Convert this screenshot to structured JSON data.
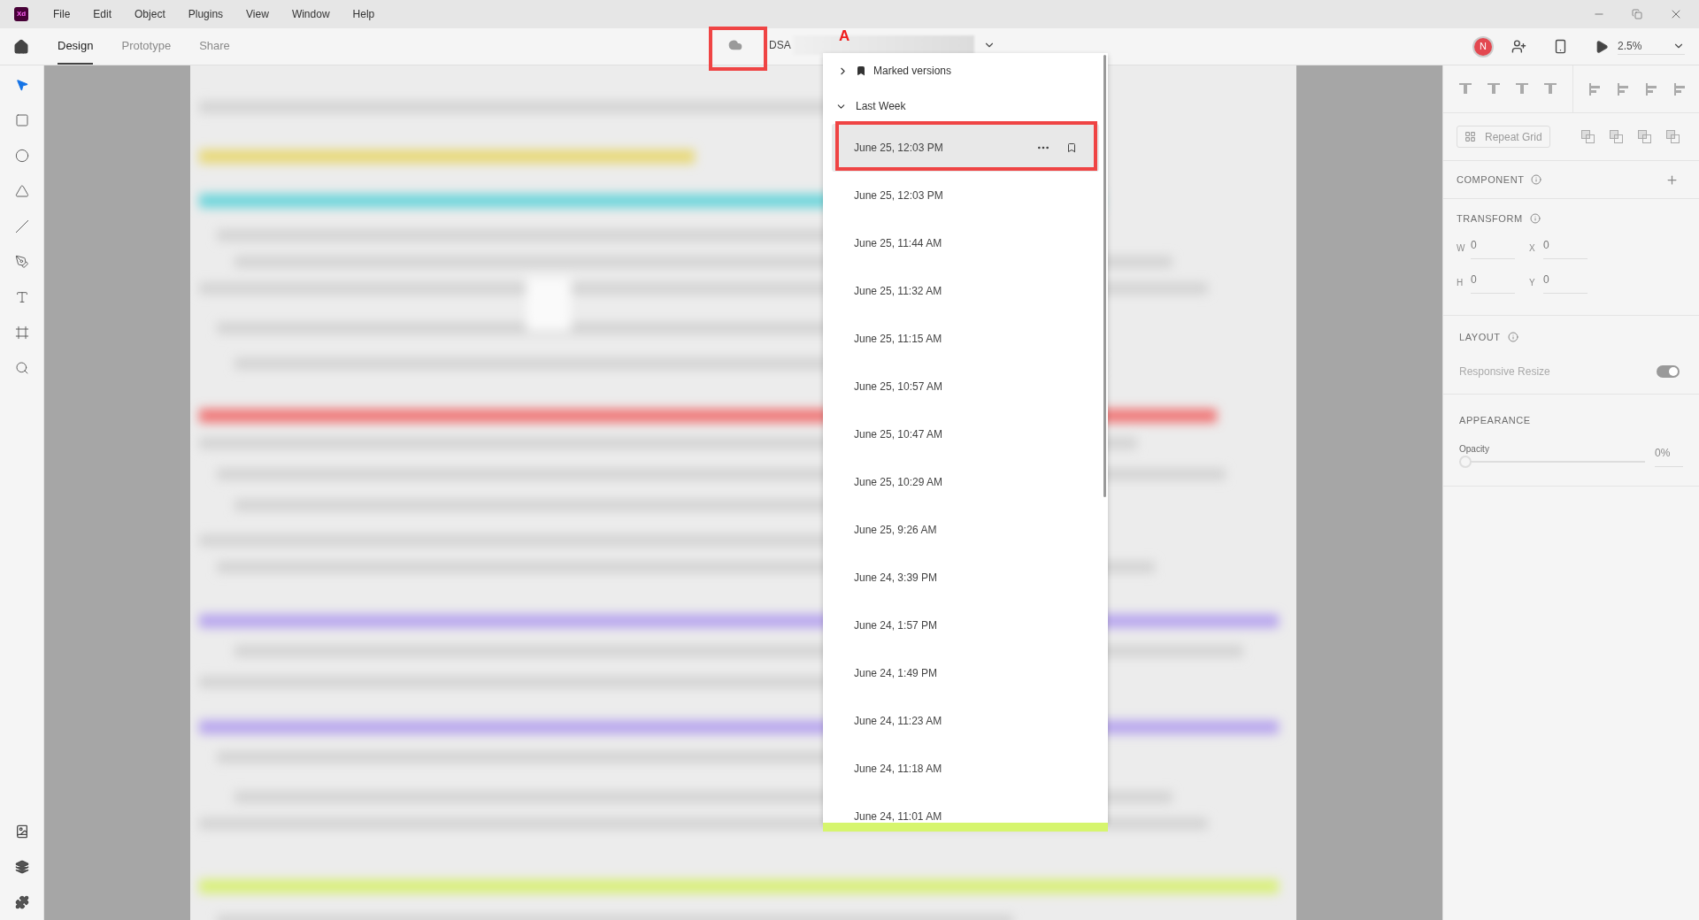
{
  "app": {
    "logo": "Xd"
  },
  "menu": [
    "File",
    "Edit",
    "Object",
    "Plugins",
    "View",
    "Window",
    "Help"
  ],
  "tabs": [
    {
      "label": "Design",
      "selected": true
    },
    {
      "label": "Prototype",
      "selected": false
    },
    {
      "label": "Share",
      "selected": false
    }
  ],
  "document": {
    "title": "DSA"
  },
  "toolbar": {
    "avatar": "N",
    "zoom": "2.5%"
  },
  "tools": [
    {
      "kind": "select",
      "selected": true
    },
    {
      "kind": "rectangle",
      "selected": false
    },
    {
      "kind": "ellipse",
      "selected": false
    },
    {
      "kind": "polygon",
      "selected": false
    },
    {
      "kind": "line",
      "selected": false
    },
    {
      "kind": "pen",
      "selected": false
    },
    {
      "kind": "text",
      "selected": false
    },
    {
      "kind": "artboard",
      "selected": false
    },
    {
      "kind": "zoom",
      "selected": false
    }
  ],
  "versions": {
    "marked": {
      "label": "Marked versions",
      "expanded": false
    },
    "last_week": {
      "label": "Last Week",
      "expanded": true,
      "items": [
        {
          "label": "June 25, 12:03 PM",
          "selected": true
        },
        {
          "label": "June 25, 12:03 PM",
          "selected": false
        },
        {
          "label": "June 25, 11:44 AM",
          "selected": false
        },
        {
          "label": "June 25, 11:32 AM",
          "selected": false
        },
        {
          "label": "June 25, 11:15 AM",
          "selected": false
        },
        {
          "label": "June 25, 10:57 AM",
          "selected": false
        },
        {
          "label": "June 25, 10:47 AM",
          "selected": false
        },
        {
          "label": "June 25, 10:29 AM",
          "selected": false
        },
        {
          "label": "June 25, 9:26 AM",
          "selected": false
        },
        {
          "label": "June 24, 3:39 PM",
          "selected": false
        },
        {
          "label": "June 24, 1:57 PM",
          "selected": false
        },
        {
          "label": "June 24, 1:49 PM",
          "selected": false
        },
        {
          "label": "June 24, 11:23 AM",
          "selected": false
        },
        {
          "label": "June 24, 11:18 AM",
          "selected": false
        },
        {
          "label": "June 24, 11:01 AM",
          "selected": false
        }
      ]
    }
  },
  "annotation": {
    "label": "A"
  },
  "properties": {
    "repeat_grid": "Repeat Grid",
    "component": {
      "label": "COMPONENT"
    },
    "transform": {
      "label": "TRANSFORM",
      "fields": [
        {
          "label": "W",
          "value": "0"
        },
        {
          "label": "X",
          "value": "0"
        },
        {
          "label": "H",
          "value": "0"
        },
        {
          "label": "Y",
          "value": "0"
        }
      ]
    },
    "layout": {
      "label": "LAYOUT",
      "responsive_resize": {
        "label": "Responsive Resize",
        "on": true
      }
    },
    "appearance": {
      "label": "APPEARANCE",
      "opacity": {
        "label": "Opacity",
        "level": 0,
        "reading": "0%"
      }
    }
  }
}
